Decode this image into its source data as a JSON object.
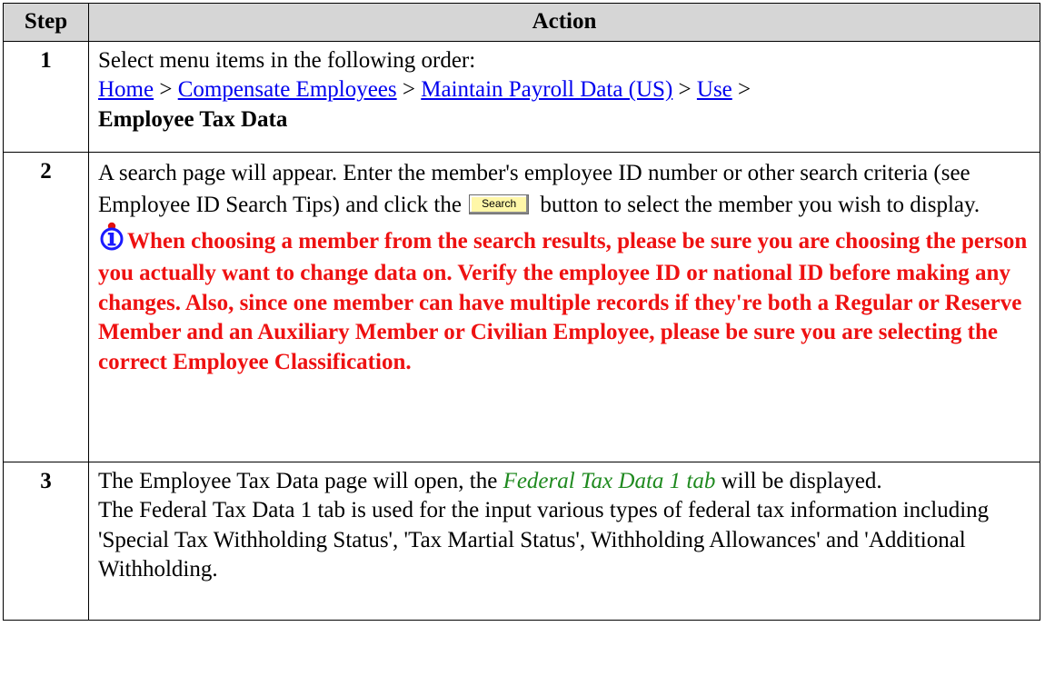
{
  "table": {
    "header_step": "Step",
    "header_action": "Action"
  },
  "steps": [
    {
      "number": "1",
      "intro": "Select menu items in the following order:",
      "path": [
        "Home",
        "Compensate Employees",
        "Maintain Payroll Data (US)",
        "Use"
      ],
      "separator": " > ",
      "final": "Employee Tax Data"
    },
    {
      "number": "2",
      "text_a": "A search page will appear. Enter the member's employee ID number or other search criteria (see Employee ID Search Tips) and click the",
      "button_label": "Search",
      "text_b": "button to select the member you wish to display.",
      "warning": "When choosing a member from the search results, please be sure you are choosing the person you actually want to change data on. Verify the employee ID or national ID before making any changes. Also, since one member can have multiple records if they're both a Regular or Reserve Member and an Auxiliary Member or Civilian Employee, please be sure you are selecting the correct Employee Classification.",
      "icon": "info-icon"
    },
    {
      "number": "3",
      "line1_a": "The Employee Tax Data page will open, the",
      "line1_em": "Federal Tax Data 1 tab",
      "line1_b": "will be displayed.",
      "line2": "The Federal Tax Data 1 tab is used for the input various types of federal tax information including 'Special Tax Withholding Status', 'Tax Martial Status', Withholding Allowances' and 'Additional Withholding."
    }
  ],
  "colors": {
    "link": "#0000ee",
    "warning": "#ee1111",
    "tab_ref": "#1f8a1f",
    "header_bg": "#d6d6d6",
    "button_bg": "#fff7a8"
  }
}
